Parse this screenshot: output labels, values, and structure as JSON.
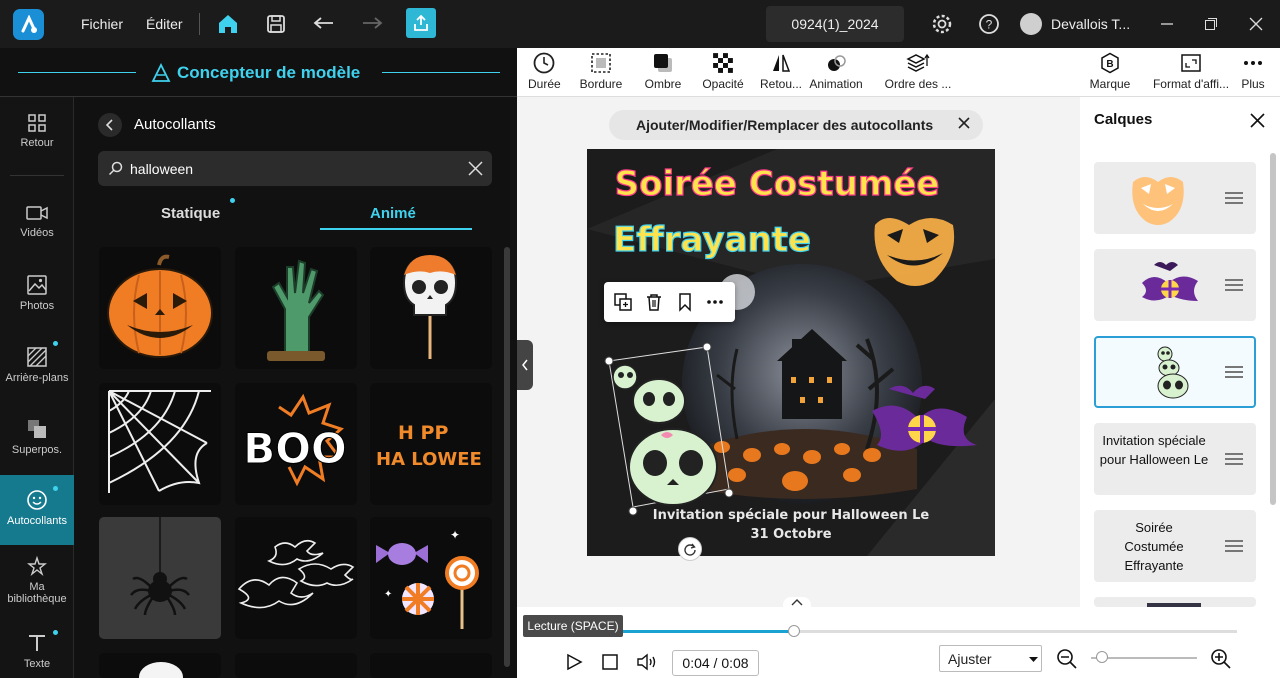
{
  "titlebar": {
    "menu_file": "Fichier",
    "menu_edit": "Éditer",
    "project_name": "0924(1)_2024",
    "username": "Devallois T..."
  },
  "panel_header": {
    "title": "Concepteur de modèle"
  },
  "rail": {
    "items": [
      {
        "label": "Retour",
        "icon": "grid-icon"
      },
      {
        "label": "Vidéos",
        "icon": "video-icon"
      },
      {
        "label": "Photos",
        "icon": "photo-icon"
      },
      {
        "label": "Arrière-plans",
        "icon": "background-icon"
      },
      {
        "label": "Superpos.",
        "icon": "overlay-icon"
      },
      {
        "label": "Autocollants",
        "icon": "sticker-icon"
      },
      {
        "label": "Ma bibliothèque",
        "icon": "library-icon"
      },
      {
        "label": "Texte",
        "icon": "text-icon"
      }
    ]
  },
  "stickers": {
    "header": "Autocollants",
    "search_value": "halloween",
    "tab_static": "Statique",
    "tab_animated": "Animé",
    "cells": [
      "pumpkin",
      "zombie-hand",
      "skull-lollipop",
      "spider-web",
      "boo",
      "happy-halloween",
      "spider",
      "bats",
      "candies"
    ],
    "boo_text": "BOO",
    "happy_line1": "H  PP",
    "happy_line2": "HA LOWEE"
  },
  "toolbar": {
    "duration": "Durée",
    "border": "Bordure",
    "shadow": "Ombre",
    "opacity": "Opacité",
    "flip": "Retou...",
    "animation": "Animation",
    "order": "Ordre des ...",
    "brand": "Marque",
    "format": "Format d'affi...",
    "more": "Plus"
  },
  "canvas": {
    "banner": "Ajouter/Modifier/Remplacer des autocollants",
    "design_title_1": "Soirée Costumée",
    "design_title_2": "Effrayante",
    "design_caption_1": "Invitation spéciale pour Halloween Le",
    "design_caption_2": "31 Octobre"
  },
  "layers": {
    "title": "Calques",
    "items": [
      {
        "type": "image",
        "name": "pumpkin-face"
      },
      {
        "type": "image",
        "name": "bat-candy"
      },
      {
        "type": "image",
        "name": "skulls",
        "selected": true
      },
      {
        "type": "text",
        "text": "Invitation spéciale pour Halloween Le"
      },
      {
        "type": "text",
        "text": "Soirée Costumée Effrayante"
      }
    ]
  },
  "playback": {
    "tooltip": "Lecture (SPACE)",
    "time": "0:04 / 0:08",
    "progress": 0.5,
    "fit": "Ajuster",
    "zoom_level": 0.1
  },
  "colors": {
    "accent": "#3fd2ee",
    "export": "#2eb8d6",
    "active_rail": "#167a8f",
    "selection": "#2a9fd6"
  }
}
